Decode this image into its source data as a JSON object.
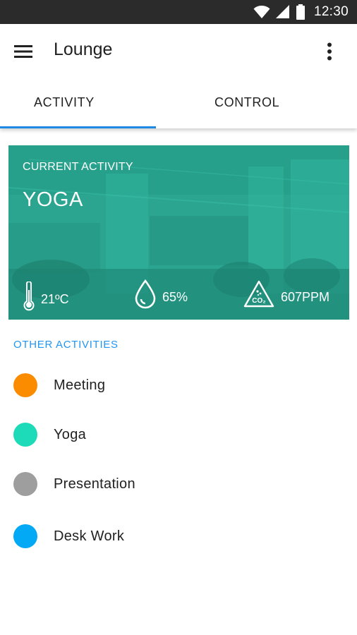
{
  "status_bar": {
    "time": "12:30"
  },
  "toolbar": {
    "title": "Lounge"
  },
  "tabs": [
    {
      "label": "ACTIVITY",
      "active": true
    },
    {
      "label": "CONTROL",
      "active": false
    }
  ],
  "current": {
    "label": "CURRENT ACTIVITY",
    "activity": "YOGA",
    "temperature": "21ºC",
    "humidity": "65%",
    "co2": "607PPM"
  },
  "other": {
    "title": "OTHER ACTIVITIES",
    "items": [
      {
        "label": "Meeting",
        "color": "#fb8c00"
      },
      {
        "label": "Yoga",
        "color": "#1ddbb9"
      },
      {
        "label": "Presentation",
        "color": "#9e9e9e"
      },
      {
        "label": "Desk Work",
        "color": "#03a9f4"
      }
    ]
  },
  "colors": {
    "accent": "#2196f3",
    "tab_indicator": "#1e88e5",
    "card": "#2aa58f"
  },
  "icons": [
    "wifi-icon",
    "signal-icon",
    "battery-icon",
    "menu-icon",
    "more-vert-icon",
    "thermometer-icon",
    "water-drop-icon",
    "co2-icon"
  ]
}
